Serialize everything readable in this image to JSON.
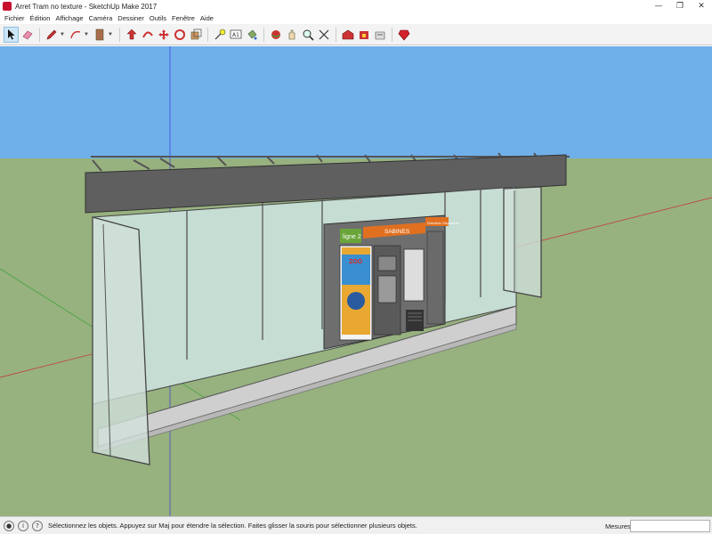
{
  "window": {
    "title": "Arret Tram no texture - SketchUp Make 2017",
    "minimize": "—",
    "maximize": "❐",
    "close": "✕"
  },
  "menu": [
    "Fichier",
    "Édition",
    "Affichage",
    "Caméra",
    "Dessiner",
    "Outils",
    "Fenêtre",
    "Aide"
  ],
  "toolbar": {
    "tools": [
      "select-icon",
      "eraser-icon",
      "pencil-icon",
      "arc-icon",
      "rectangle-icon",
      "push-pull-icon",
      "follow-me-icon",
      "move-icon",
      "rotate-icon",
      "scale-icon",
      "tape-measure-icon",
      "text-icon",
      "paint-bucket-icon",
      "orbit-icon",
      "pan-icon",
      "zoom-icon",
      "zoom-extents-icon",
      "warehouse-icon",
      "extension-warehouse-icon",
      "sign-in-icon"
    ]
  },
  "scene": {
    "sign_ligne": "ligne 2",
    "sign_station": "SABINES",
    "sign_direction": "Direction Odysseum",
    "poster_text": "ZOO"
  },
  "colors": {
    "sky": "#6fb0ea",
    "ground": "#97b17f",
    "glass": "#c4dbd1",
    "frame": "#5d5d5d",
    "accent": "#e07020"
  },
  "status": {
    "message": "Sélectionnez les objets. Appuyez sur Maj pour étendre la sélection. Faites glisser la souris pour sélectionner plusieurs objets.",
    "measures_label": "Mesures",
    "measures_value": ""
  }
}
